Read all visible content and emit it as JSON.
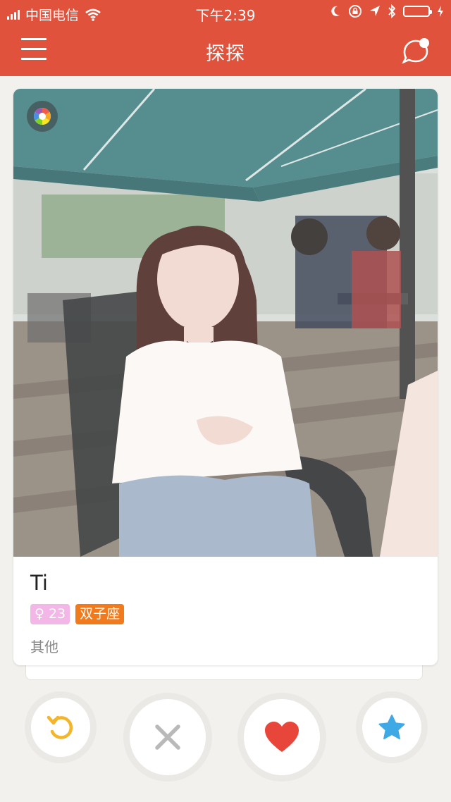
{
  "status_bar": {
    "carrier": "中国电信",
    "time": "下午2:39"
  },
  "header": {
    "title": "探探",
    "menu_icon": "menu-icon",
    "chat_icon": "chat-bubble-icon"
  },
  "profile_card": {
    "name": "Ti",
    "gender_age": "♀ 23",
    "zodiac": "双子座",
    "occupation": "其他",
    "photo_description_icon": "color-wheel-icon"
  },
  "actions": {
    "undo_icon": "undo-icon",
    "nope_icon": "close-icon",
    "like_icon": "heart-icon",
    "superlike_icon": "star-icon"
  },
  "colors": {
    "brand": "#e0523c",
    "gender_badge": "#f2b7e6",
    "zodiac_badge": "#f07a1c",
    "undo": "#f2b52c",
    "nope": "#b9b9b9",
    "like": "#e8463a",
    "superlike": "#3fa9e6"
  }
}
